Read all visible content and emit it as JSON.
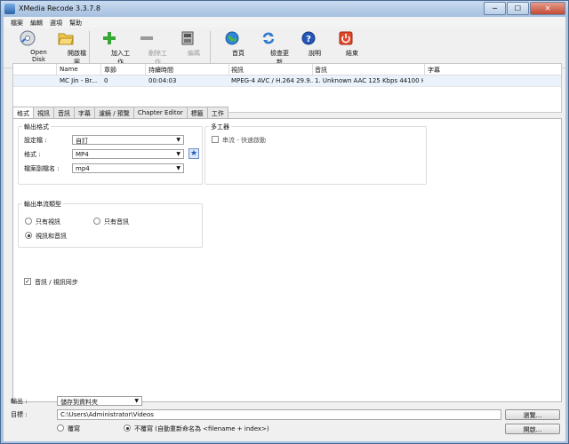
{
  "window": {
    "title": "XMedia Recode 3.3.7.8",
    "min": "─",
    "max": "☐",
    "close": "✕"
  },
  "menu": [
    "檔案",
    "編輯",
    "選項",
    "幫助"
  ],
  "toolbar": {
    "open_disk": "Open Disk",
    "open_file": "開啟檔案",
    "add_job": "加入工作",
    "remove_job": "刪除工作",
    "encode": "編碼",
    "home": "首頁",
    "check_update": "檢查更新",
    "help": "說明",
    "exit": "結束"
  },
  "grid": {
    "headers": [
      "Name",
      "章節",
      "持續時間",
      "視訊",
      "音訊",
      "字幕"
    ],
    "row": [
      "MC Jin - Br...",
      "0",
      "00:04:03",
      "MPEG-4 AVC / H.264 29.9...",
      "1. Unknown AAC  125 Kbps 44100 H...",
      ""
    ]
  },
  "tabs": [
    "格式",
    "視訊",
    "音訊",
    "字幕",
    "濾鏡 / 預覽",
    "Chapter Editor",
    "標籤",
    "工作"
  ],
  "format_panel": {
    "output_format_title": "輸出格式",
    "profile_label": "設定檔 :",
    "profile_value": "自訂",
    "format_label": "格式 :",
    "format_value": "MP4",
    "ext_label": "檔案副檔名 :",
    "ext_value": "mp4",
    "multiplexer_title": "多工器",
    "streaming_label": "串流 - 快速啟動",
    "stream_type_title": "輸出串流類型",
    "video_only": "只有視訊",
    "audio_only": "只有音訊",
    "video_audio": "視訊和音訊",
    "av_sync_label": "音訊 / 視訊同步"
  },
  "bottom": {
    "output_label": "輸出 :",
    "output_value": "儲存到資料夾",
    "target_label": "目標 :",
    "target_path": "C:\\Users\\Administrator\\Videos",
    "browse": "瀏覽...",
    "overwrite": "覆寫",
    "no_overwrite": "不覆寫 (自動重新命名為 <filename + index>)",
    "open": "開啟..."
  }
}
